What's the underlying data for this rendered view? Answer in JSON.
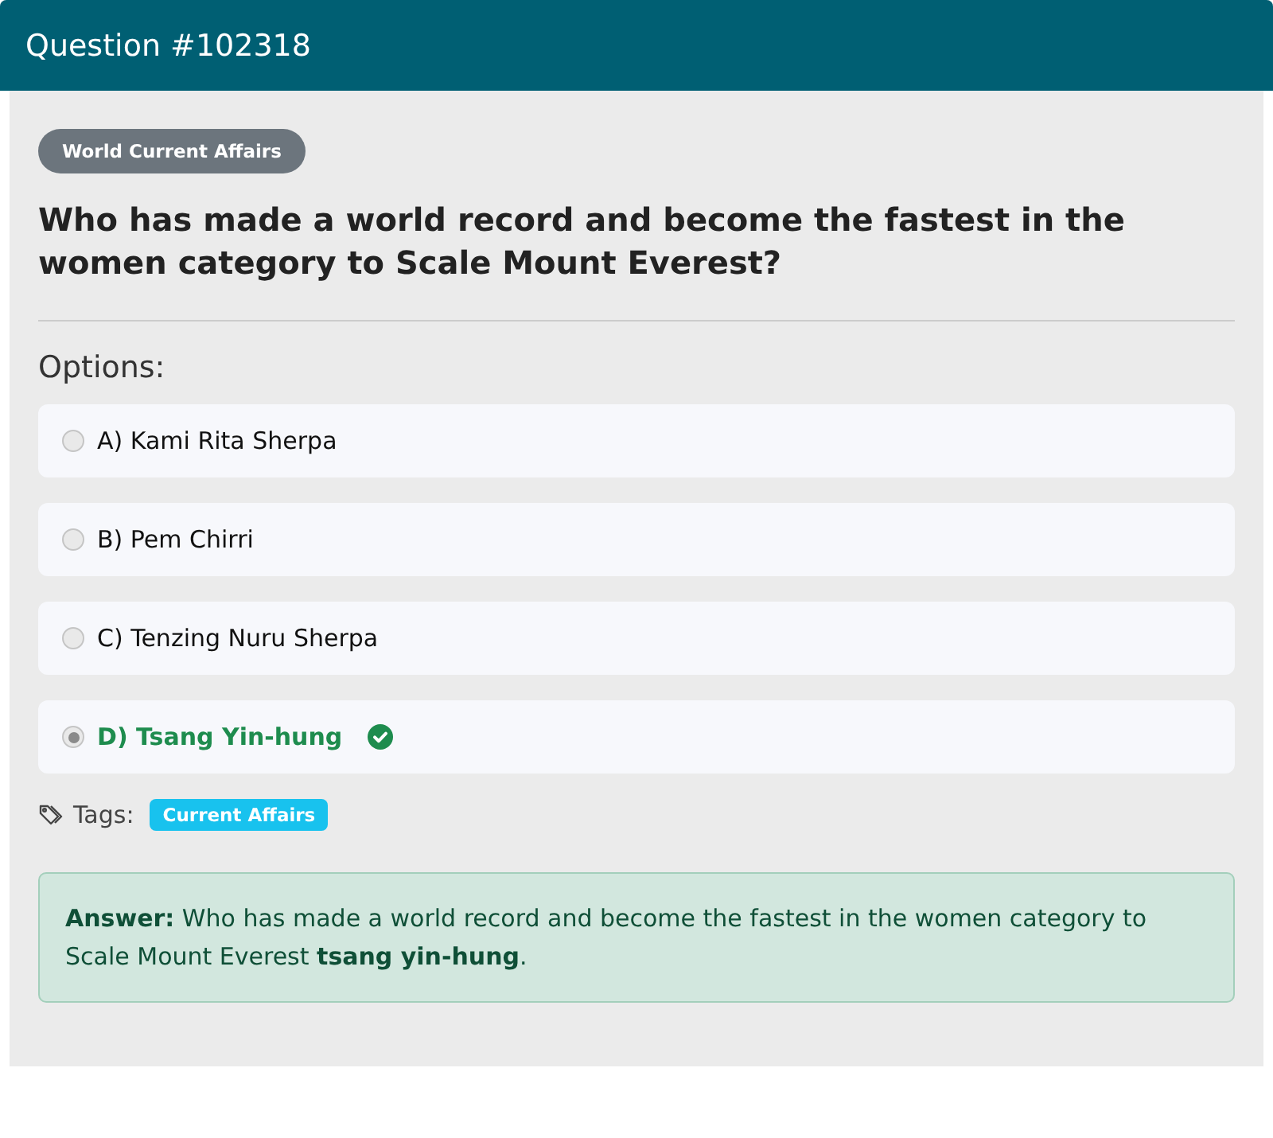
{
  "header": {
    "title": "Question #102318"
  },
  "category": "World Current Affairs",
  "question": "Who has made a world record and become the fastest in the women category to Scale Mount Everest?",
  "options_label": "Options:",
  "options": [
    {
      "label": "A) Kami Rita Sherpa",
      "selected": false,
      "correct": false
    },
    {
      "label": "B) Pem Chirri",
      "selected": false,
      "correct": false
    },
    {
      "label": "C) Tenzing Nuru Sherpa",
      "selected": false,
      "correct": false
    },
    {
      "label": "D) Tsang Yin-hung",
      "selected": true,
      "correct": true
    }
  ],
  "tags_label": "Tags:",
  "tags": [
    "Current Affairs"
  ],
  "answer": "**Answer:** Who has made a world record and become the fastest in the women category to Scale Mount Everest **tsang yin-hung**."
}
